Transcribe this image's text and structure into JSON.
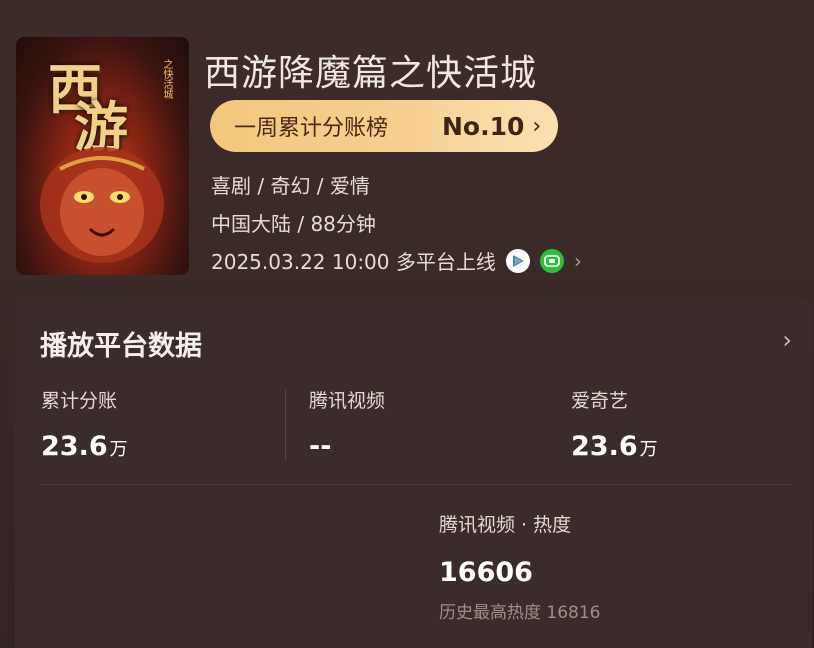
{
  "movie": {
    "title": "西游降魔篇之快活城",
    "poster_title_1": "西",
    "poster_title_2": "游",
    "poster_subtitle": "之快活城",
    "rank_label": "一周累计分账榜",
    "rank_value": "No.10",
    "genres": "喜剧 / 奇幻 / 爱情",
    "region_runtime": "中国大陆 / 88分钟",
    "release": "2025.03.22 10:00 多平台上线"
  },
  "platform_card": {
    "title": "播放平台数据",
    "stats": [
      {
        "label": "累计分账",
        "value": "23.6",
        "unit": "万"
      },
      {
        "label": "腾讯视频",
        "value": "--",
        "unit": ""
      },
      {
        "label": "爱奇艺",
        "value": "23.6",
        "unit": "万"
      }
    ],
    "heat": {
      "label": "腾讯视频 · 热度",
      "value": "16606",
      "history": "历史最高热度 16816"
    }
  },
  "icons": {
    "tencent": "tencent-video-icon",
    "iqiyi": "iqiyi-icon",
    "chevron": "chevron-right-icon"
  },
  "colors": {
    "background": "#3a2a28",
    "badge_gold": "#f3c77b",
    "card": "#3a2c2b",
    "iqiyi_green": "#2fbf3c"
  }
}
